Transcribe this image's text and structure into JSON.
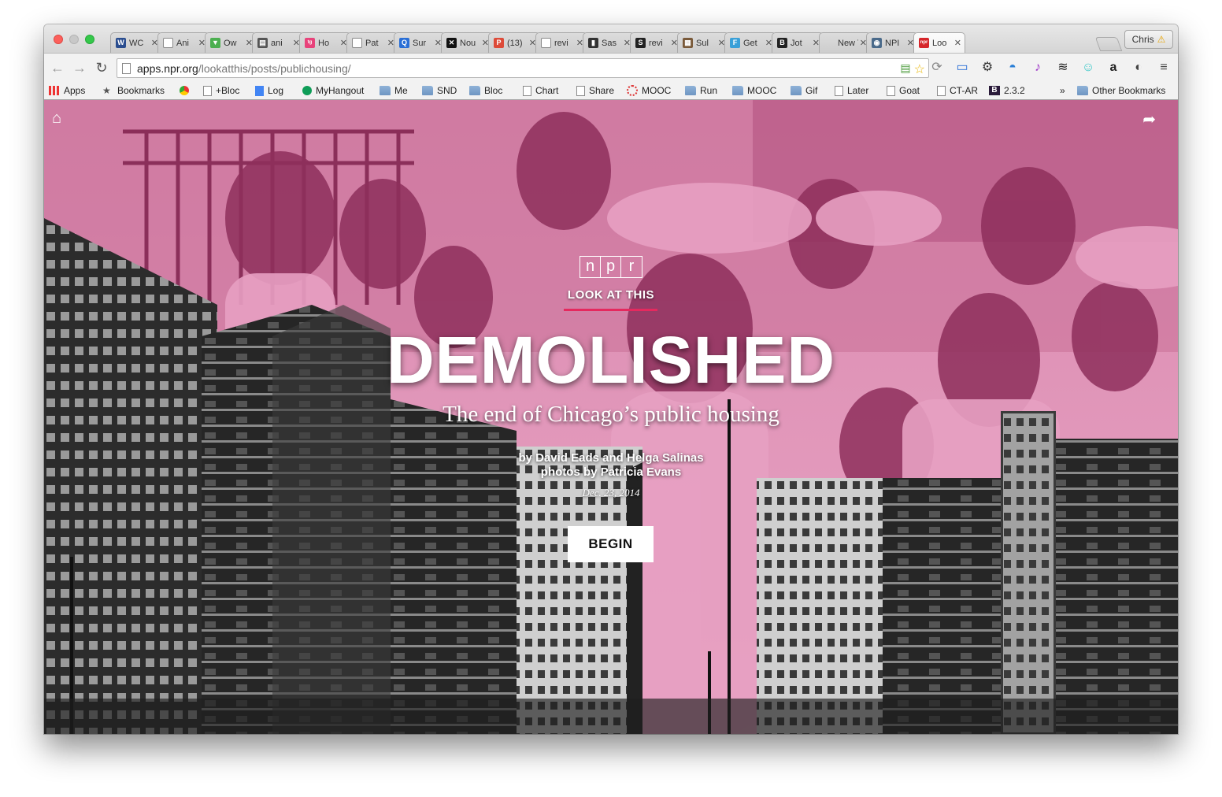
{
  "browser": {
    "tabs": [
      {
        "title": "WC",
        "icon": "w-favicon",
        "color": "#2a4d8f",
        "glyph": "W"
      },
      {
        "title": "Ani",
        "icon": "page-favicon",
        "color": "#ffffff",
        "glyph": ""
      },
      {
        "title": "Ow",
        "icon": "owl-favicon",
        "color": "#4caf50",
        "glyph": "▼"
      },
      {
        "title": "ani",
        "icon": "doc-favicon",
        "color": "#555555",
        "glyph": "▤"
      },
      {
        "title": "Ho",
        "icon": "tg-favicon",
        "color": "#e8437b",
        "glyph": "tg"
      },
      {
        "title": "Pat",
        "icon": "page-favicon",
        "color": "#ffffff",
        "glyph": ""
      },
      {
        "title": "Sur",
        "icon": "q-favicon",
        "color": "#2a6fd6",
        "glyph": "Q"
      },
      {
        "title": "Nou",
        "icon": "nyt-favicon",
        "color": "#111111",
        "glyph": "✕"
      },
      {
        "title": "(13)",
        "icon": "p-favicon",
        "color": "#dd4b39",
        "glyph": "P"
      },
      {
        "title": "revi",
        "icon": "page-favicon",
        "color": "#ffffff",
        "glyph": ""
      },
      {
        "title": "Sas",
        "icon": "book-favicon",
        "color": "#333333",
        "glyph": "▮"
      },
      {
        "title": "revi",
        "icon": "s-favicon",
        "color": "#222222",
        "glyph": "S"
      },
      {
        "title": "Sul",
        "icon": "image-favicon",
        "color": "#7a5a3a",
        "glyph": "▦"
      },
      {
        "title": "Get",
        "icon": "f-favicon",
        "color": "#3aa0d8",
        "glyph": "F"
      },
      {
        "title": "Jot",
        "icon": "b-favicon",
        "color": "#222222",
        "glyph": "B"
      },
      {
        "title": "New T",
        "icon": "none",
        "color": "#ececec",
        "glyph": ""
      },
      {
        "title": "NPI",
        "icon": "eye-favicon",
        "color": "#4a6a8a",
        "glyph": "◉"
      },
      {
        "title": "Loo",
        "icon": "npr-favicon",
        "color": "#d6262b",
        "glyph": "npr"
      }
    ],
    "profile_name": "Chris",
    "profile_warning": "⚠",
    "url_host": "apps.npr.org",
    "url_path": "/lookatthis/posts/publichousing/",
    "bookmarks": [
      {
        "label": "Apps",
        "icon": "apps-grid-icon"
      },
      {
        "label": "Bookmarks",
        "icon": "star-icon"
      },
      {
        "label": "",
        "icon": "chrome-icon"
      },
      {
        "label": "+Bloc",
        "icon": "page-icon"
      },
      {
        "label": "Log",
        "icon": "docs-icon"
      },
      {
        "label": "MyHangout",
        "icon": "hangout-icon"
      },
      {
        "label": "Me",
        "icon": "folder-icon"
      },
      {
        "label": "SND",
        "icon": "folder-icon"
      },
      {
        "label": "Bloc",
        "icon": "folder-icon"
      },
      {
        "label": "Chart",
        "icon": "page-icon"
      },
      {
        "label": "Share",
        "icon": "page-icon"
      },
      {
        "label": "MOOC",
        "icon": "ring-icon"
      },
      {
        "label": "Run",
        "icon": "folder-icon"
      },
      {
        "label": "MOOC",
        "icon": "folder-icon"
      },
      {
        "label": "Gif",
        "icon": "folder-icon"
      },
      {
        "label": "Later",
        "icon": "page-icon"
      },
      {
        "label": "Goat",
        "icon": "page-icon"
      },
      {
        "label": "CT-AR",
        "icon": "page-icon"
      },
      {
        "label": "2.3.2",
        "icon": "b-icon"
      }
    ],
    "bookmarks_overflow": "»",
    "other_bookmarks": "Other Bookmarks"
  },
  "page": {
    "logo_letters": [
      "n",
      "p",
      "r"
    ],
    "kicker": "LOOK AT THIS",
    "headline": "DEMOLISHED",
    "subhead": "The end of Chicago’s public housing",
    "byline": "by David Eads and Helga Salinas",
    "photo_credit": "photos by Patricia Evans",
    "date": "Dec. 23, 2014",
    "begin_label": "BEGIN",
    "accent_color": "#e5295e",
    "tint_color": "#e98fb8"
  }
}
